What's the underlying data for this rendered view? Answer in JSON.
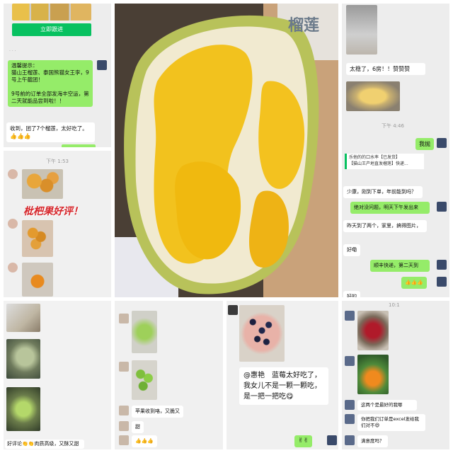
{
  "top_left": {
    "card_button": "立即跟进",
    "notice": "温馨提示：\n猫山王榴莲、泰国熊猫女王李，9号上午截团！\n\n9号前的订单全部发海丰空运，第二天就能品尝到啦！！",
    "customer_msg": "收到，团了7个榴莲，太好吃了。",
    "emojis": "👍👍👍"
  },
  "left_mid": {
    "time": "下午 1:53",
    "sticker_text": "枇杷果好评！"
  },
  "top_right": {
    "msg1": "太稳了，6房！！赞赞赞",
    "time": "下午 4:46",
    "msg_green": "我抛",
    "card_title": "乐他的的口水率【已发货】",
    "card_sub": "【猫山王产地直发榴莲】快递...",
    "msg2": "少康，刚到下单，年前能到吗？",
    "msg3": "绝对没问题，明天下午发出来",
    "msg4": "昨天到了两个，家里，搞得图片，",
    "msg5": "好嘞",
    "msg6": "顺丰快递，第二天到",
    "emojis": "👍👍👍",
    "msg7": "好的"
  },
  "bottom_left": {
    "caption": "好评论👏👏肉质高级，又酥又甜"
  },
  "bottom_mid_left": {
    "msg1": "苹果收到咯，又脆又",
    "msg2": "甜",
    "emojis": "👍👍👍"
  },
  "bottom_center": {
    "message": "@惠艳　蓝莓太好吃了，我女儿不是一颗一颗吃，是一把一把吃😋",
    "reply": "✌✌"
  },
  "bottom_right": {
    "time": "10:1",
    "msg1": "这两个是最好的我哪",
    "msg2": "你把我们订单是excel发给我们对不😄",
    "msg3": "满意度吗？"
  },
  "center": {
    "banner_text": "榴莲"
  }
}
